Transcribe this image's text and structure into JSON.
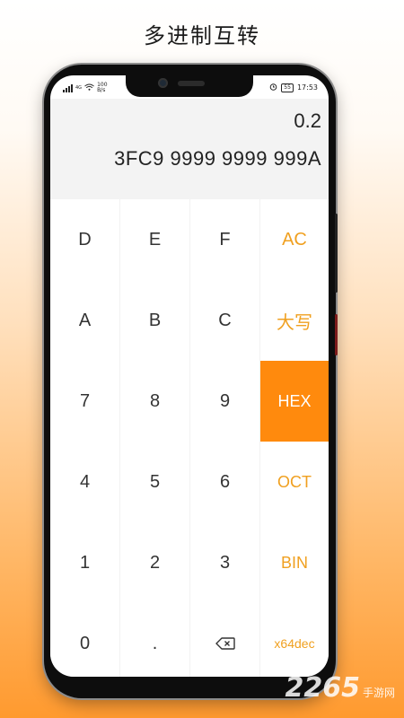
{
  "promo": {
    "title": "多进制互转"
  },
  "status_bar": {
    "net_speed_value": "100",
    "net_speed_unit": "B/s",
    "battery": "55",
    "time": "17:53",
    "network": "4G"
  },
  "display": {
    "expression": "0.2",
    "result": "3FC9 9999 9999 999A"
  },
  "keypad": {
    "row1": [
      "D",
      "E",
      "F",
      "AC"
    ],
    "row2": [
      "A",
      "B",
      "C",
      "大写"
    ],
    "row3": [
      "7",
      "8",
      "9",
      "HEX"
    ],
    "row4": [
      "4",
      "5",
      "6",
      "OCT"
    ],
    "row5": [
      "1",
      "2",
      "3",
      "BIN"
    ],
    "row6": [
      "0",
      ".",
      "",
      "x64dec"
    ]
  },
  "colors": {
    "accent": "#f0a020",
    "active_key": "#ff8a0d",
    "display_bg": "#f3f3f3"
  },
  "watermark": {
    "number": "2265",
    "text": "手游网"
  }
}
